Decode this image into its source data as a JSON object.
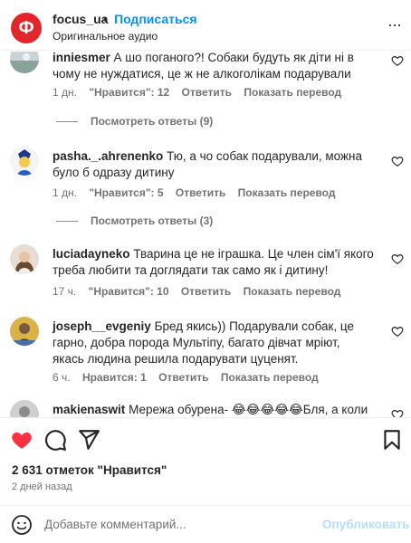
{
  "header": {
    "logo_letter": "Ф",
    "account": "focus_ua",
    "dot": "•",
    "follow": "Подписаться",
    "audio": "Оригинальное аудио",
    "more": "..."
  },
  "comments": [
    {
      "user": "inniesmer",
      "text": "А шо поганого?! Собаки будуть як діти ні в чому не нуждатися, це ж не алкоголікам подарували",
      "time": "1 дн.",
      "likes": "\"Нравится\": 12",
      "reply": "Ответить",
      "translate": "Показать перевод",
      "replies": "Посмотреть ответы (9)"
    },
    {
      "user": "pasha._.ahrenenko",
      "text": "Тю, а чо собак подарували, можна було б одразу дитину",
      "time": "1 дн.",
      "likes": "\"Нравится\": 5",
      "reply": "Ответить",
      "translate": "Показать перевод",
      "replies": "Посмотреть ответы (3)"
    },
    {
      "user": "luciadayneko",
      "text": "Тварина це не іграшка. Це член сім'ї якого треба любити та доглядати так само як і дитину!",
      "time": "17 ч.",
      "likes": "\"Нравится\": 10",
      "reply": "Ответить",
      "translate": "Показать перевод"
    },
    {
      "user": "joseph__evgeniy",
      "text": "Бред якись)) Подарували собак, це гарно, добра порода Мультіпу, багато дівчат мріют, якась людина решила подарувати цуценят.",
      "time": "6 ч.",
      "likes": "Нравится: 1",
      "reply": "Ответить",
      "translate": "Показать перевод"
    },
    {
      "user": "makienaswit",
      "text": "Мережа обурена- 😂😂😂😂😂Бля, а коли"
    }
  ],
  "actions": {
    "like_icon": "heart-filled-icon",
    "comment_icon": "comment-icon",
    "share_icon": "share-icon",
    "save_icon": "bookmark-icon",
    "like_color": "#ff3040"
  },
  "likes": "2 631 отметок \"Нравится\"",
  "age": "2 дней назад",
  "composer": {
    "placeholder": "Добавьте комментарий...",
    "publish": "Опубликовать",
    "emoji_icon": "smiley-icon"
  }
}
